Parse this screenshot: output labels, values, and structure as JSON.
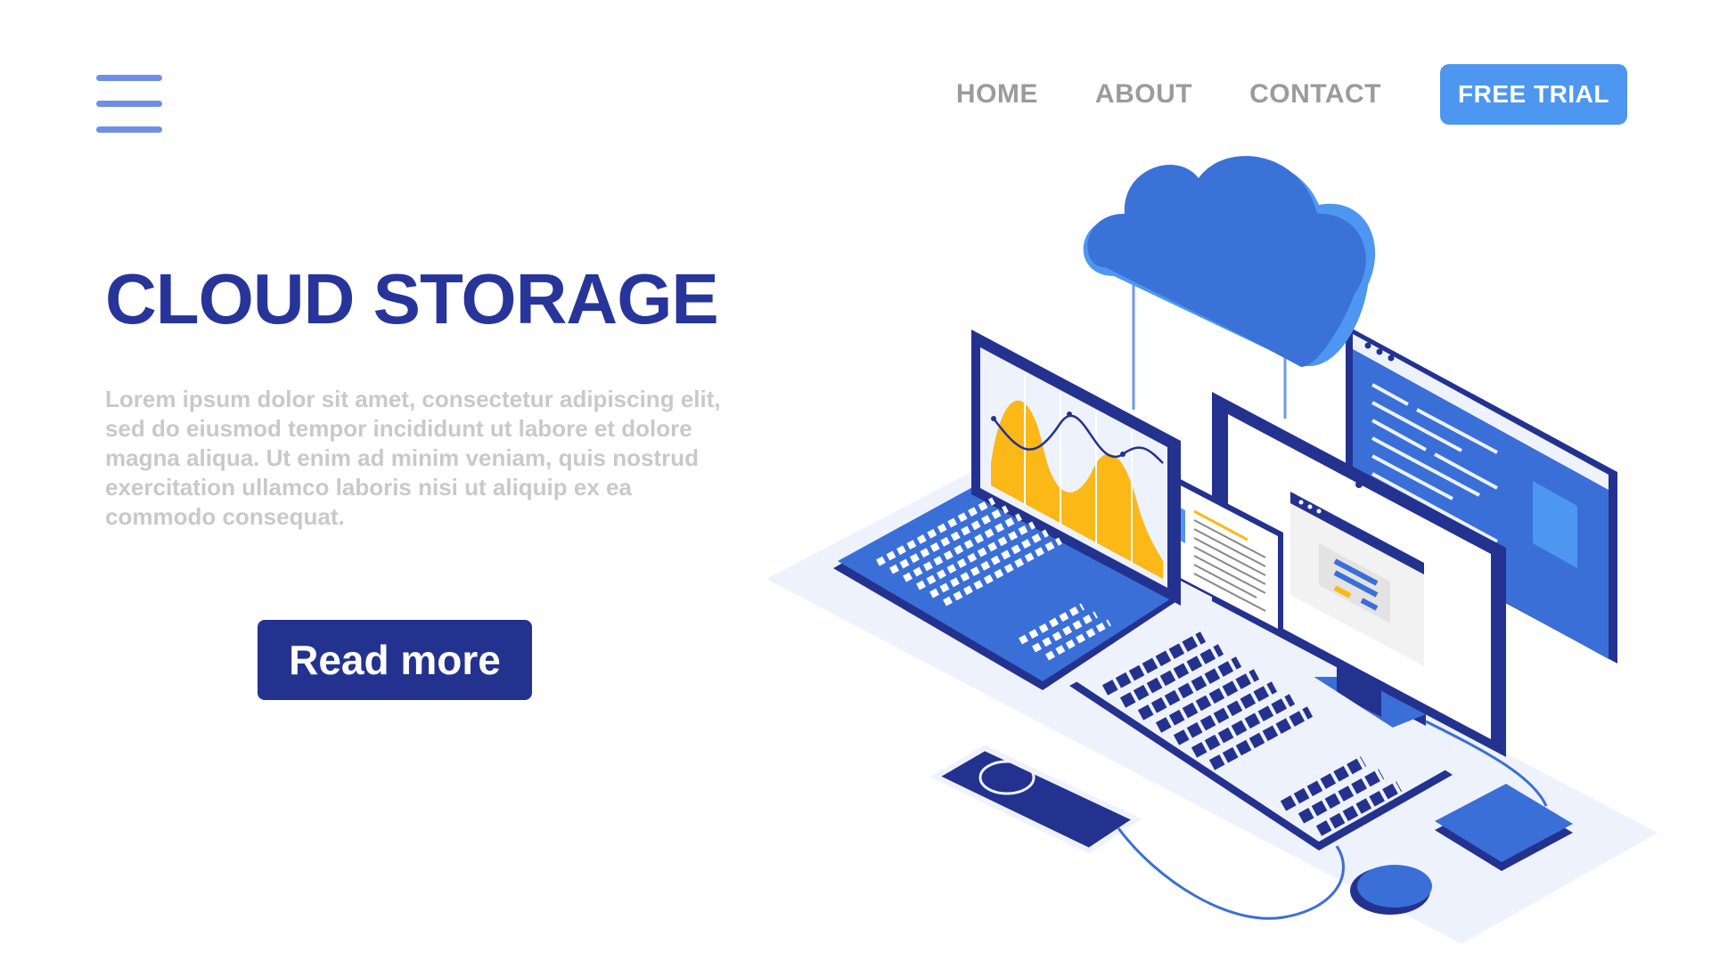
{
  "header": {
    "menu_icon": "hamburger-menu-icon",
    "nav": [
      {
        "label": "HOME"
      },
      {
        "label": "ABOUT"
      },
      {
        "label": "CONTACT"
      }
    ],
    "cta_label": "FREE TRIAL"
  },
  "hero": {
    "title": "CLOUD STORAGE",
    "body": "Lorem ipsum dolor sit amet, consectetur adipiscing elit, sed do eiusmod tempor incididunt ut labore et dolore magna aliqua. Ut enim ad minim veniam, quis nostrud exercitation ullamco laboris nisi ut aliquip ex ea commodo consequat.",
    "button_label": "Read more"
  },
  "illustration": {
    "icon": "cloud-storage-devices-illustration",
    "colors": {
      "dark_blue": "#24328f",
      "mid_blue": "#3a6fd8",
      "light_blue": "#4d97f0",
      "pale_blue": "#eef2fd",
      "chart_yellow": "#fbb817"
    }
  }
}
